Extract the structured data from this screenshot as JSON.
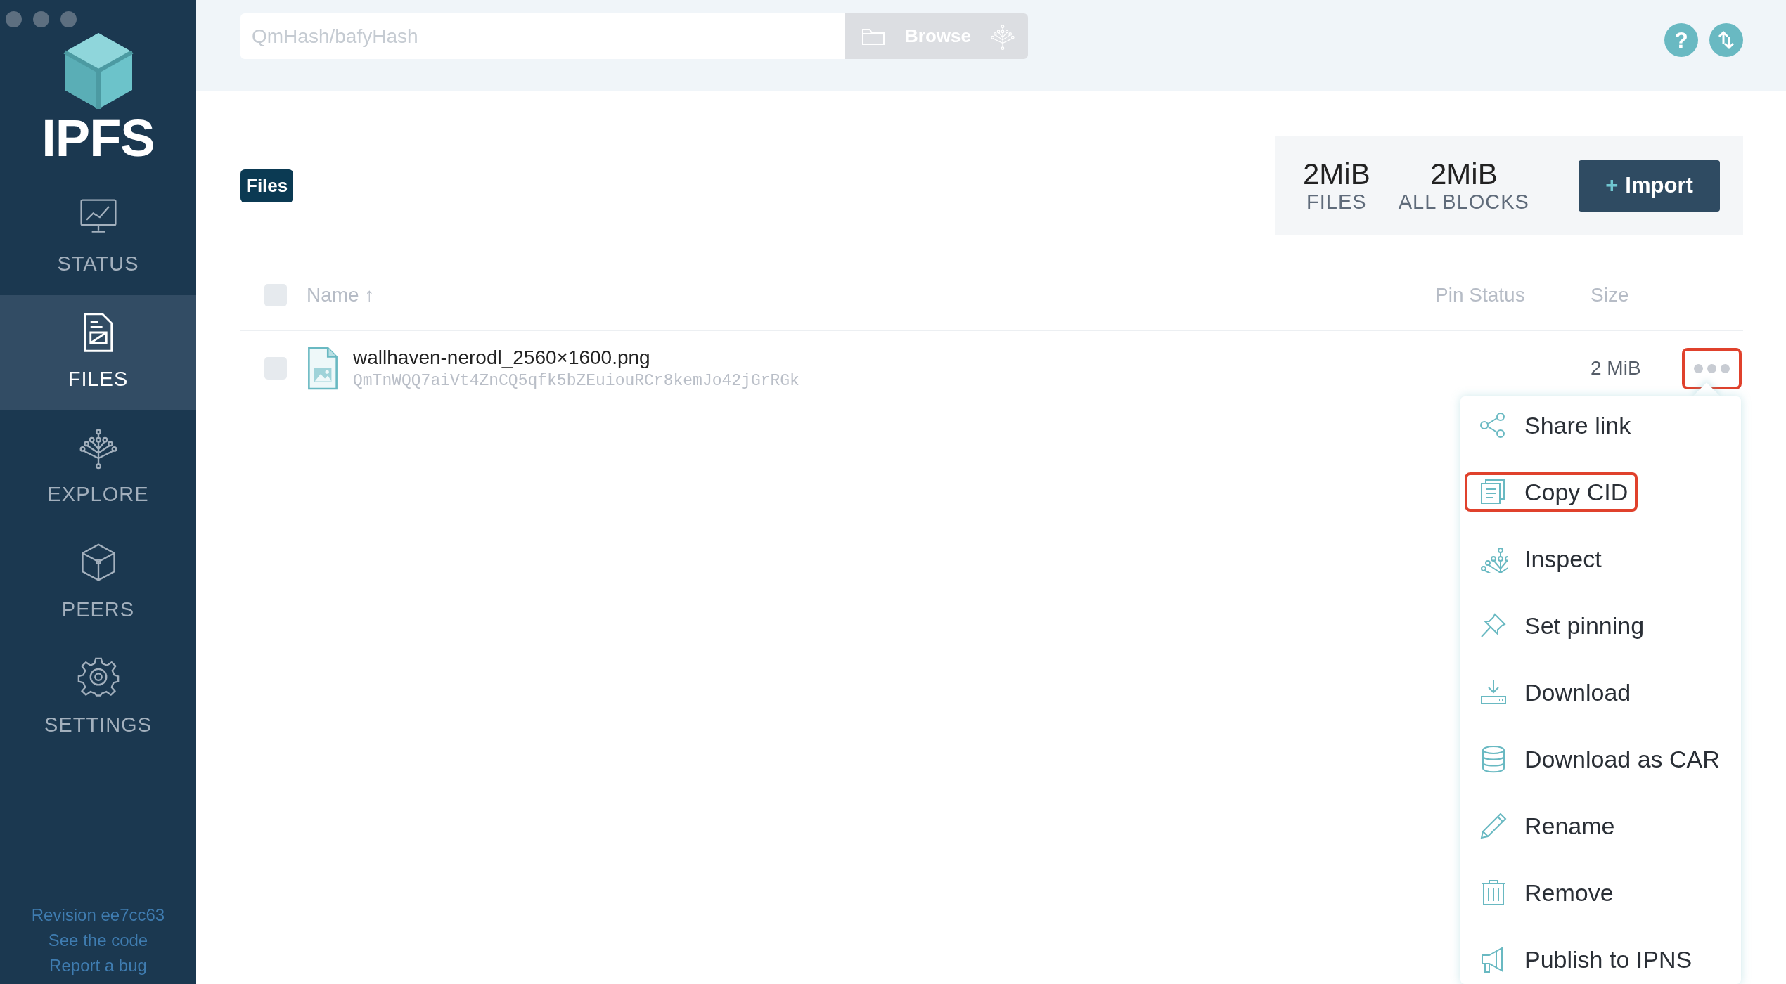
{
  "sidebar": {
    "logo_text": "IPFS",
    "items": [
      {
        "kind": "status",
        "label": "STATUS",
        "selected": false
      },
      {
        "kind": "files",
        "label": "FILES",
        "selected": true
      },
      {
        "kind": "explore",
        "label": "EXPLORE",
        "selected": false
      },
      {
        "kind": "peers",
        "label": "PEERS",
        "selected": false
      },
      {
        "kind": "settings",
        "label": "SETTINGS",
        "selected": false
      }
    ],
    "footer_links": [
      "Revision ee7cc63",
      "See the code",
      "Report a bug"
    ]
  },
  "topbar": {
    "search": {
      "placeholder": "QmHash/bafyHash"
    },
    "browse_button": "Browse",
    "help_button": "?"
  },
  "breadcrumb": "Files",
  "stats": [
    {
      "value": "2MiB",
      "label": "FILES"
    },
    {
      "value": "2MiB",
      "label": "ALL BLOCKS"
    }
  ],
  "import_button": {
    "plus": "+",
    "label": "Import"
  },
  "table": {
    "select_all_checked": false,
    "columns": [
      {
        "label": "Name",
        "sort": "↑"
      },
      {
        "label": "Pin Status"
      },
      {
        "label": "Size"
      }
    ],
    "rows": [
      {
        "checked": false,
        "name": "wallhaven-nerodl_2560×1600.png",
        "cid": "QmTnWQQ7aiVt4ZnCQ5qfk5bZEuiouRCr8kemJo42jGrRGk",
        "size": "2 MiB",
        "more_highlighted": true
      }
    ]
  },
  "context_menu": {
    "items": [
      {
        "kind": "share",
        "label": "Share link",
        "highlighted": false
      },
      {
        "kind": "copy",
        "label": "Copy CID",
        "highlighted": true
      },
      {
        "kind": "inspect",
        "label": "Inspect",
        "highlighted": false
      },
      {
        "kind": "pin",
        "label": "Set pinning",
        "highlighted": false
      },
      {
        "kind": "download",
        "label": "Download",
        "highlighted": false
      },
      {
        "kind": "car",
        "label": "Download as CAR",
        "highlighted": false
      },
      {
        "kind": "rename",
        "label": "Rename",
        "highlighted": false
      },
      {
        "kind": "remove",
        "label": "Remove",
        "highlighted": false
      },
      {
        "kind": "publish",
        "label": "Publish to IPNS",
        "highlighted": false
      }
    ]
  }
}
